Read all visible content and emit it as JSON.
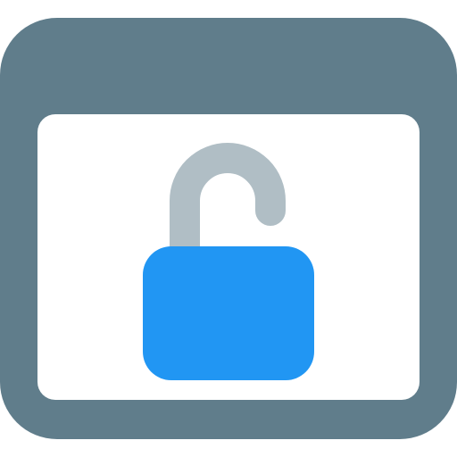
{
  "icon": {
    "semantic_name": "browser-window-unlocked-padlock-icon",
    "colors": {
      "frame": "#607D8B",
      "content_area": "#FFFFFF",
      "shackle": "#B0BEC5",
      "lock_body": "#2196F3"
    }
  }
}
